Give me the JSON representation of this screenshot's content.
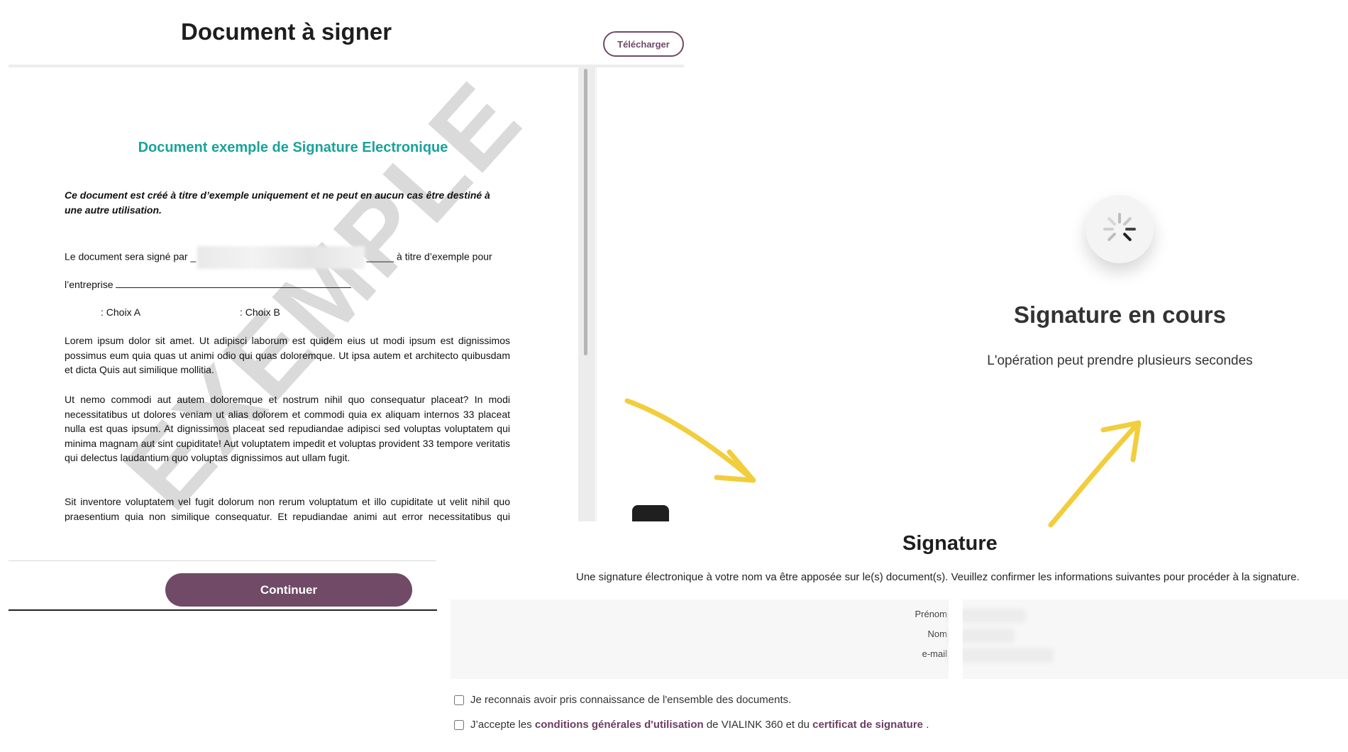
{
  "doc_viewer": {
    "title": "Document à signer",
    "download_label": "Télécharger",
    "continue_label": "Continuer",
    "page": {
      "title": "Document exemple de Signature Electronique",
      "italic_notice": "Ce document est créé à titre d’exemple uniquement et ne peut en aucun cas être destiné à une autre utilisation.",
      "signed_by_prefix": "Le document sera signé par _",
      "signed_by_suffix": "_____ à titre d’exemple pour",
      "company_prefix": "l’entreprise",
      "choice_a": ": Choix A",
      "choice_b": ": Choix B",
      "paragraphs": [
        "Lorem ipsum dolor sit amet. Ut adipisci laborum est quidem eius ut modi ipsum est dignissimos possimus eum quia quas ut animi odio qui quas doloremque. Ut ipsa autem et architecto quibusdam et dicta Quis aut similique mollitia.",
        "Ut nemo commodi aut autem doloremque et nostrum nihil quo consequatur placeat? In modi necessitatibus ut dolores veniam ut alias dolorem et commodi quia ex aliquam internos 33 placeat nulla est quas ipsum. At dignissimos placeat sed repudiandae adipisci sed voluptas voluptatem qui minima magnam aut sint cupiditate! Aut voluptatem impedit et voluptas provident 33 tempore veritatis qui delectus laudantium quo voluptas dignissimos aut ullam fugit.",
        "Sit inventore voluptatem vel fugit dolorum non rerum voluptatum et illo cupiditate ut velit nihil quo praesentium quia non similique consequatur. Et repudiandae animi aut error necessitatibus qui laudantium totam sit laudantium magni eos minus rerum a non atque enim?"
      ],
      "watermark": "EXEMPLE"
    }
  },
  "progress": {
    "title": "Signature en cours",
    "subtitle": "L'opération peut prendre plusieurs secondes",
    "icon": "spinner-icon"
  },
  "signature": {
    "title": "Signature",
    "description": "Une signature électronique à votre nom va être apposée sur le(s) document(s). Veuillez confirmer les informations suivantes pour procéder à la signature.",
    "fields": [
      {
        "label": "Prénom"
      },
      {
        "label": "Nom"
      },
      {
        "label": "e-mail"
      }
    ],
    "check_documents": "Je reconnais avoir pris connaissance de l'ensemble des documents.",
    "check_terms_prefix": "J’accepte les",
    "terms_link": "conditions générales d'utilisation",
    "terms_middle": "de VIALINK 360 et du",
    "certificate_link": "certificat de signature",
    "terms_suffix": "."
  },
  "colors": {
    "brand": "#704a66",
    "doc_title_teal": "#1aa39a",
    "arrow_yellow": "#f2cd3c"
  }
}
